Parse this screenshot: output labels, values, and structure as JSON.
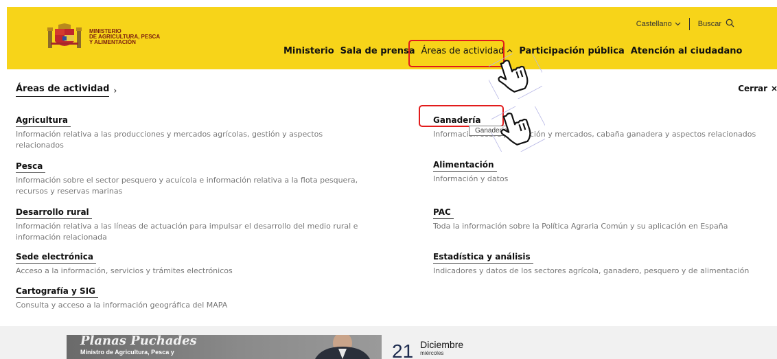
{
  "header": {
    "ministry_lines": [
      "MINISTERIO",
      "DE AGRICULTURA, PESCA",
      "Y ALIMENTACIÓN"
    ],
    "language": "Castellano",
    "search_label": "Buscar",
    "nav": [
      {
        "label": "Ministerio"
      },
      {
        "label": "Sala de prensa"
      },
      {
        "label": "Áreas de actividad"
      },
      {
        "label": "Participación pública"
      },
      {
        "label": "Atención al ciudadano"
      }
    ],
    "colors": {
      "brand_yellow": "#f7d419",
      "highlight": "#e21b1b"
    }
  },
  "menu": {
    "breadcrumb": "Áreas de actividad",
    "close_label": "Cerrar",
    "left": [
      {
        "title": "Agricultura",
        "desc": "Información relativa a las producciones y mercados agrícolas, gestión y aspectos relacionados"
      },
      {
        "title": "Pesca",
        "desc": "Información sobre el sector pesquero y acuícola e información relativa a la flota pesquera, recursos y reservas marinas"
      },
      {
        "title": "Desarrollo rural",
        "desc": "Información relativa a las líneas de actuación para impulsar el desarrollo del medio rural e información relacionada"
      },
      {
        "title": "Sede electrónica",
        "desc": "Acceso a la información, servicios y trámites electrónicos"
      },
      {
        "title": "Cartografía y SIG",
        "desc": "Consulta y acceso a la información geográfica del MAPA"
      }
    ],
    "right": [
      {
        "title": "Ganadería",
        "desc": "Información sobre producción y mercados, cabaña ganadera y aspectos relacionados"
      },
      {
        "title": "Alimentación",
        "desc": "Información y datos"
      },
      {
        "title": "PAC",
        "desc": "Toda la información sobre la Política Agraria Común y su aplicación en España"
      },
      {
        "title": "Estadística y análisis",
        "desc": "Indicadores y datos de los sectores agrícola, ganadero, pesquero y de alimentación"
      }
    ],
    "tooltip": "Ganadería"
  },
  "bottom": {
    "minister_name": "Planas Puchades",
    "minister_role": "Ministro de Agricultura, Pesca y",
    "day": "21",
    "month": "Diciembre",
    "weekday": "miércoles"
  }
}
